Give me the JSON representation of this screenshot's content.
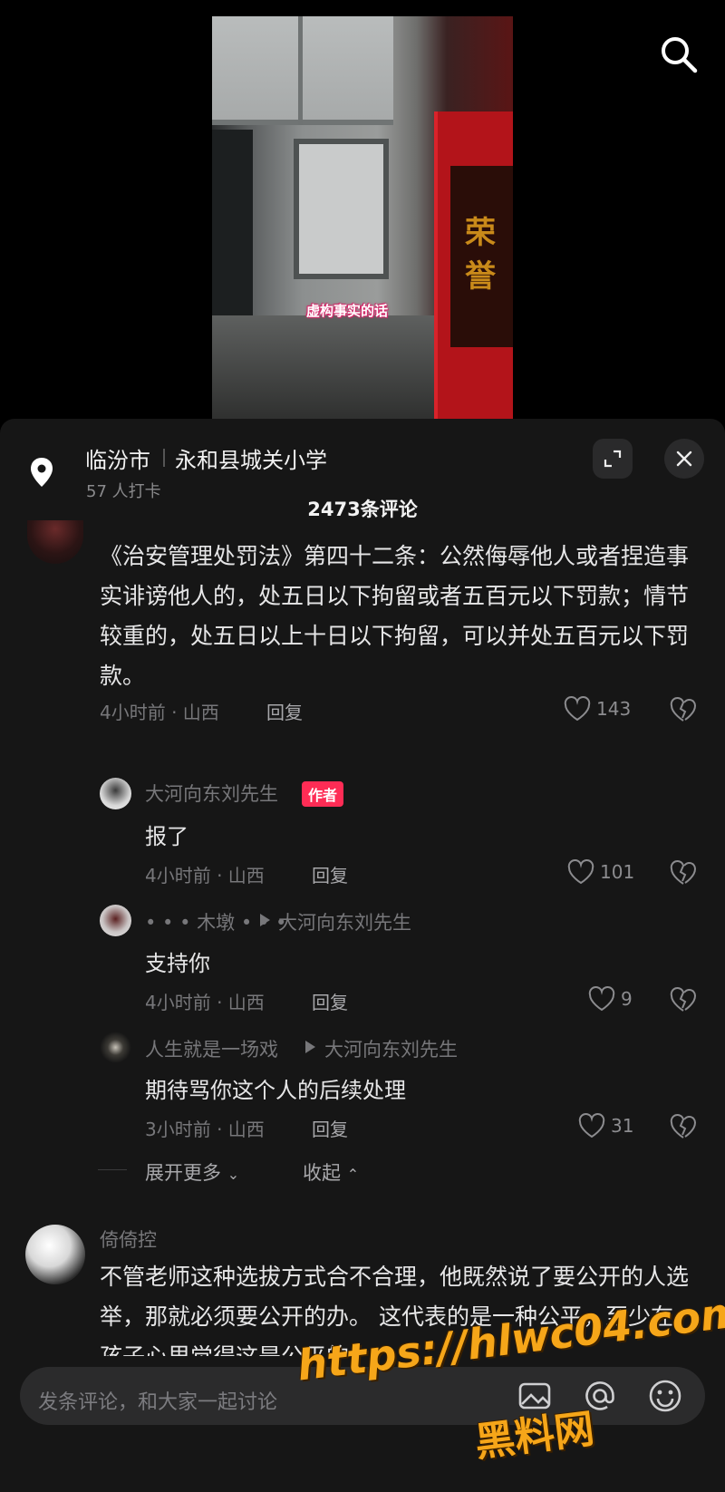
{
  "video": {
    "caption": "虚构事实的话",
    "board_text": "荣誉"
  },
  "location": {
    "city": "临汾市",
    "place": "永和县城关小学",
    "checkin": "57 人打卡"
  },
  "comments_header": {
    "count_label": "2473条评论"
  },
  "comment_main": {
    "text": "《治安管理处罚法》第四十二条：公然侮辱他人或者捏造事实诽谤他人的，处五日以下拘留或者五百元以下罚款；情节较重的，处五日以上十日以下拘留，可以并处五百元以下罚款。",
    "meta": "4小时前 · 山西",
    "reply_label": "回复",
    "likes": "143"
  },
  "replies": [
    {
      "author": "大河向东刘先生",
      "tag": "作者",
      "reply_to": "",
      "text": "报了",
      "meta": "4小时前 · 山西",
      "reply_label": "回复",
      "likes": "101"
    },
    {
      "author": "• • • 木墩 • • •",
      "tag": "",
      "reply_to": "大河向东刘先生",
      "text": "支持你",
      "meta": "4小时前 · 山西",
      "reply_label": "回复",
      "likes": "9"
    },
    {
      "author": "人生就是一场戏",
      "tag": "",
      "reply_to": "大河向东刘先生",
      "text": "期待骂你这个人的后续处理",
      "meta": "3小时前 · 山西",
      "reply_label": "回复",
      "likes": "31"
    }
  ],
  "thread_controls": {
    "expand_more": "展开更多",
    "collapse": "收起"
  },
  "comment_next": {
    "author": "倚倚控",
    "text": "不管老师这种选拔方式合不合理，他既然说了要公开的人选举，那就必须要公开的办。 这代表的是一种公平，至少在孩子心里觉得这是公平的。"
  },
  "input": {
    "placeholder": "发条评论，和大家一起讨论"
  },
  "watermark": {
    "line1": "https://hlwc04.com",
    "line2": "黑料网"
  },
  "icons": [
    "search-icon",
    "location-pin-icon",
    "expand-icon",
    "close-icon",
    "heart-icon",
    "broken-heart-icon",
    "image-icon",
    "at-icon",
    "emoji-icon"
  ],
  "colors": {
    "author_tag": "#fe2c55",
    "sheet_bg": "#161616",
    "watermark": "#f6a619"
  }
}
